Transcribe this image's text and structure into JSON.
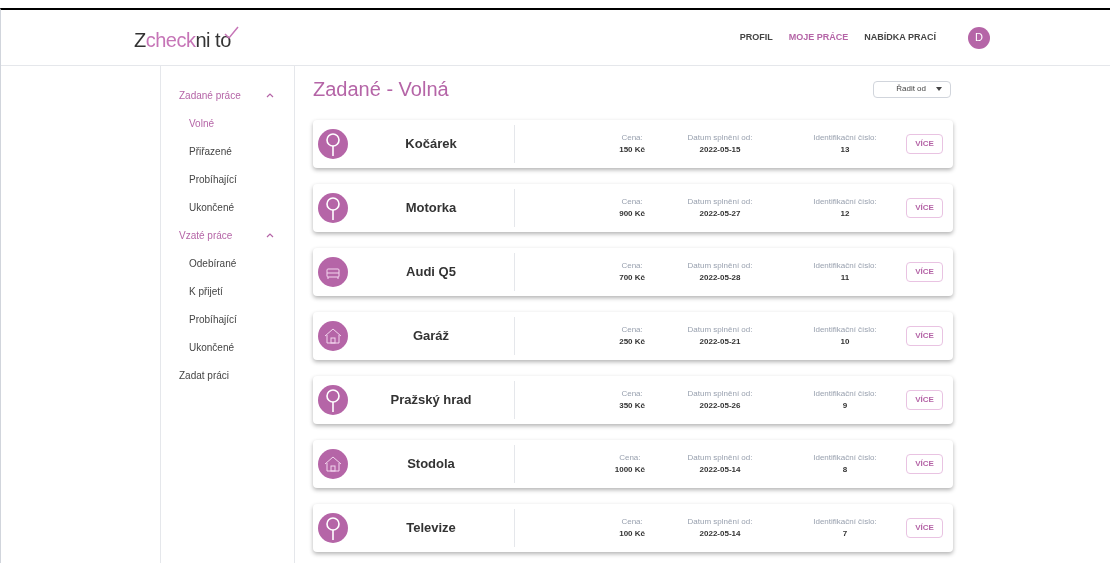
{
  "logo": {
    "parts": [
      {
        "text": "Z",
        "accent": false
      },
      {
        "text": "check",
        "accent": true
      },
      {
        "text": "ni t",
        "accent": false
      },
      {
        "text": "o",
        "accent": false,
        "tick": true
      }
    ]
  },
  "nav": [
    {
      "label": "PROFIL",
      "selected": false
    },
    {
      "label": "MOJE PRÁCE",
      "selected": true
    },
    {
      "label": "NABÍDKA PRACÍ",
      "selected": false
    }
  ],
  "avatar": "D",
  "sidebar": [
    {
      "label": "Zadané práce",
      "expanded": true,
      "selected": true,
      "children": [
        {
          "label": "Volné",
          "selected": true
        },
        {
          "label": "Přiřazené",
          "selected": false
        },
        {
          "label": "Probíhající",
          "selected": false
        },
        {
          "label": "Ukončené",
          "selected": false
        }
      ]
    },
    {
      "label": "Vzaté práce",
      "expanded": true,
      "selected": true,
      "children": [
        {
          "label": "Odebírané",
          "selected": false
        },
        {
          "label": "K přijetí",
          "selected": false
        },
        {
          "label": "Probíhající",
          "selected": false
        },
        {
          "label": "Ukončené",
          "selected": false
        }
      ]
    },
    {
      "label": "Zadat práci",
      "selected": false
    }
  ],
  "title": "Zadané - Volná",
  "sort": {
    "label": "Řadit od"
  },
  "jobs": [
    {
      "kind": "search",
      "name": "Kočárek",
      "price_label": "Cena:",
      "price": "150 Kč",
      "date_label": "Datum splnění od:",
      "date": "2022-05-15",
      "id_label": "Identifikační číslo:",
      "id": "13",
      "button": "VÍCE"
    },
    {
      "kind": "search",
      "name": "Motorka",
      "price_label": "Cena:",
      "price": "900 Kč",
      "date_label": "Datum splnění od:",
      "date": "2022-05-27",
      "id_label": "Identifikační číslo:",
      "id": "12",
      "button": "VÍCE"
    },
    {
      "kind": "car",
      "name": "Audi Q5",
      "price_label": "Cena:",
      "price": "700 Kč",
      "date_label": "Datum splnění od:",
      "date": "2022-05-28",
      "id_label": "Identifikační číslo:",
      "id": "11",
      "button": "VÍCE"
    },
    {
      "kind": "house",
      "name": "Garáž",
      "price_label": "Cena:",
      "price": "250 Kč",
      "date_label": "Datum splnění od:",
      "date": "2022-05-21",
      "id_label": "Identifikační číslo:",
      "id": "10",
      "button": "VÍCE"
    },
    {
      "kind": "search",
      "name": "Pražský hrad",
      "price_label": "Cena:",
      "price": "350 Kč",
      "date_label": "Datum splnění od:",
      "date": "2022-05-26",
      "id_label": "Identifikační číslo:",
      "id": "9",
      "button": "VÍCE"
    },
    {
      "kind": "house",
      "name": "Stodola",
      "price_label": "Cena:",
      "price": "1000 Kč",
      "date_label": "Datum splnění od:",
      "date": "2022-05-14",
      "id_label": "Identifikační číslo:",
      "id": "8",
      "button": "VÍCE"
    },
    {
      "kind": "search",
      "name": "Televize",
      "price_label": "Cena:",
      "price": "100 Kč",
      "date_label": "Datum splnění od:",
      "date": "2022-05-14",
      "id_label": "Identifikační číslo:",
      "id": "7",
      "button": "VÍCE"
    }
  ]
}
